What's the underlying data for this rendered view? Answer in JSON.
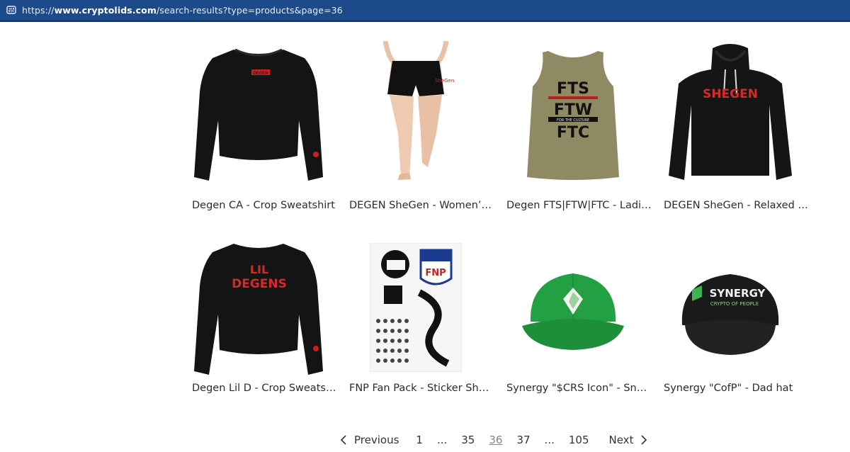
{
  "browser": {
    "url_prefix": "https://",
    "url_host": "www.cryptolids.com",
    "url_path": "/search-results?type=products&page=36"
  },
  "products": [
    {
      "title": "Degen CA - Crop Sweatshirt",
      "image": "crop-sweatshirt-black"
    },
    {
      "title": "DEGEN SheGen - Women’s ...",
      "image": "athletic-shorts-black"
    },
    {
      "title": "Degen FTS|FTW|FTC - Ladie...",
      "image": "muscle-tank-olive"
    },
    {
      "title": "DEGEN SheGen - Relaxed Li...",
      "image": "hoodie-black"
    },
    {
      "title": "Degen Lil D - Crop Sweatshi...",
      "image": "crop-sweatshirt-black-print"
    },
    {
      "title": "FNP Fan Pack - Sticker Sheet",
      "image": "sticker-sheet"
    },
    {
      "title": "Synergy \"$CRS Icon\" - Snap...",
      "image": "snapback-green"
    },
    {
      "title": "Synergy \"CofP\" - Dad hat",
      "image": "dad-hat-black"
    }
  ],
  "product_art": {
    "shirt_print_1": "DEGEN",
    "shorts_print": "SheGen",
    "tank_lines": [
      "FTS",
      "FTW",
      "FTC"
    ],
    "tank_banner": "FOR THE CULTURE",
    "hoodie_print": "SHEGEN",
    "shirt_print_2": [
      "LIL",
      "DEGENS"
    ],
    "sticker_logo": "FNP",
    "hat_brand": "SYNERGY",
    "hat_tagline": "CRYPTO OF PEOPLE"
  },
  "pagination": {
    "previous": "Previous",
    "next": "Next",
    "pages": [
      "1",
      "...",
      "35",
      "36",
      "37",
      "...",
      "105"
    ],
    "current": "36"
  },
  "colors": {
    "url_bar": "#1c4a8a",
    "accent_red": "#d42a2a",
    "tank_olive": "#8f8a64",
    "hat_green": "#22a043"
  }
}
